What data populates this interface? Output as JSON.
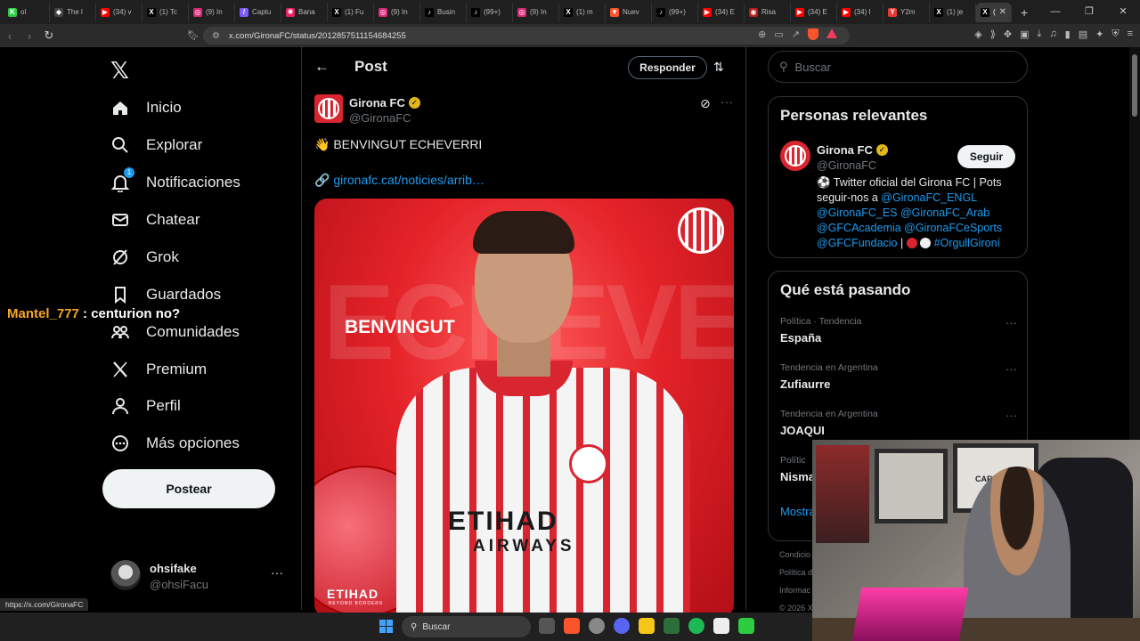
{
  "browser": {
    "tabs": [
      {
        "label": "ol",
        "color": "#2ecc40",
        "glyph": "K"
      },
      {
        "label": "The l",
        "color": "#444",
        "glyph": "◆"
      },
      {
        "label": "(34) v",
        "color": "#ff0000",
        "glyph": "▶"
      },
      {
        "label": "(1) Tc",
        "color": "#000",
        "glyph": "X"
      },
      {
        "label": "(9) In",
        "color": "#d62976",
        "glyph": "◎"
      },
      {
        "label": "Captu",
        "color": "#7b5cff",
        "glyph": "/"
      },
      {
        "label": "Bana",
        "color": "#e91e63",
        "glyph": "✱"
      },
      {
        "label": "(1) Fu",
        "color": "#000",
        "glyph": "X"
      },
      {
        "label": "(9) In",
        "color": "#d62976",
        "glyph": "◎"
      },
      {
        "label": "Busin",
        "color": "#000",
        "glyph": "♪"
      },
      {
        "label": "(99+)",
        "color": "#000",
        "glyph": "♪"
      },
      {
        "label": "(9) In",
        "color": "#d62976",
        "glyph": "◎"
      },
      {
        "label": "(1) m",
        "color": "#000",
        "glyph": "X"
      },
      {
        "label": "Nuev",
        "color": "#fb542b",
        "glyph": "▼"
      },
      {
        "label": "(99+)",
        "color": "#000",
        "glyph": "♪"
      },
      {
        "label": "(34) E",
        "color": "#ff0000",
        "glyph": "▶"
      },
      {
        "label": "Risa",
        "color": "#b71c1c",
        "glyph": "◉"
      },
      {
        "label": "(34) E",
        "color": "#ff0000",
        "glyph": "▶"
      },
      {
        "label": "(34) I",
        "color": "#ff0000",
        "glyph": "▶"
      },
      {
        "label": "Y2m",
        "color": "#e53935",
        "glyph": "Y"
      },
      {
        "label": "(1) je",
        "color": "#000",
        "glyph": "X"
      }
    ],
    "active_tab": {
      "label": "(",
      "glyph": "X"
    },
    "url": "x.com/GironaFC/status/2012857511154684255",
    "status_url": "https://x.com/GironaFC"
  },
  "sidebar": {
    "logo": "𝕏",
    "items": [
      {
        "label": "Inicio",
        "icon": "home-icon"
      },
      {
        "label": "Explorar",
        "icon": "search-icon"
      },
      {
        "label": "Notificaciones",
        "icon": "bell-icon",
        "badge": "1"
      },
      {
        "label": "Chatear",
        "icon": "mail-icon"
      },
      {
        "label": "Grok",
        "icon": "grok-icon"
      },
      {
        "label": "Guardados",
        "icon": "bookmark-icon"
      },
      {
        "label": "Comunidades",
        "icon": "communities-icon"
      },
      {
        "label": "Premium",
        "icon": "x-icon"
      },
      {
        "label": "Perfil",
        "icon": "person-icon"
      },
      {
        "label": "Más opciones",
        "icon": "more-circle-icon"
      }
    ],
    "post_label": "Postear",
    "profile": {
      "name": "ohsifake",
      "handle": "@ohsiFacu"
    }
  },
  "chat_overlay": {
    "user": "Mantel_777",
    "message": " : centurion no?"
  },
  "main": {
    "title": "Post",
    "reply_label": "Responder",
    "tweet": {
      "name": "Girona FC",
      "handle": "@GironaFC",
      "text": "👋 BENVINGUT ECHEVERRI",
      "link_prefix": "🔗 ",
      "link": "gironafc.cat/noticies/arrib…",
      "media": {
        "bg_name": "ECHEVERRI",
        "headline": "BENVINGUT",
        "sponsor": "ETIHAD",
        "sponsor_sub": "AIRWAYS",
        "footer": "ETIHAD",
        "footer_sub": "BEYOND BORDERS"
      }
    }
  },
  "right": {
    "search_placeholder": "Buscar",
    "relevant_title": "Personas relevantes",
    "relevant": {
      "name": "Girona FC",
      "handle": "@GironaFC",
      "follow_label": "Seguir",
      "bio_start": "⚽ Twitter oficial del Girona FC | Pots seguir-nos a ",
      "bio_mentions": "@GironaFC_ENGL @GironaFC_ES @GironaFC_Arab @GFCAcademia @GironaFCeSports @GFCFundacio",
      "bio_sep": " | ",
      "bio_tag": " #OrgullGironí"
    },
    "trending_title": "Qué está pasando",
    "trends": [
      {
        "meta": "Política · Tendencia",
        "name": "España"
      },
      {
        "meta": "Tendencia en Argentina",
        "name": "Zufiaurre"
      },
      {
        "meta": "Tendencia en Argentina",
        "name": "JOAQUI"
      },
      {
        "meta": "Polític",
        "name": "Nisma"
      }
    ],
    "show_more": "Mostra",
    "footer": [
      "Condicio",
      "Política d",
      "Informac",
      "© 2026 X"
    ]
  },
  "cam": {
    "poster_text": "CARAGGE"
  },
  "taskbar": {
    "search_label": "Buscar"
  },
  "colors": {
    "accent": "#1d9bf0",
    "verified": "#e2b719",
    "girona_red": "#d9252f"
  }
}
